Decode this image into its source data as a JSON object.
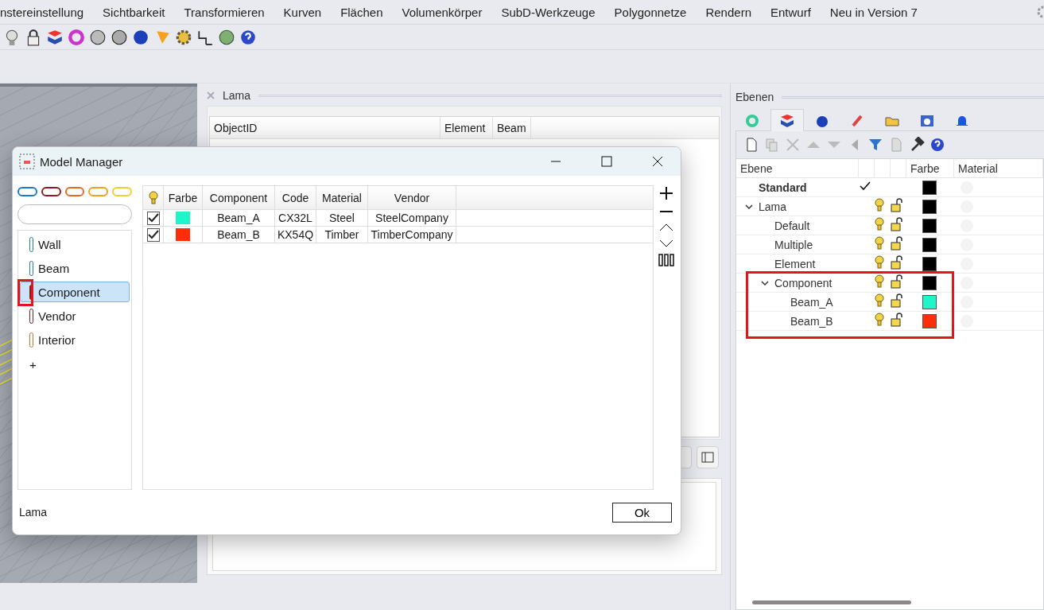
{
  "menu": [
    {
      "label": "nstereinstellung"
    },
    {
      "label": "Sichtbarkeit"
    },
    {
      "label": "Transformieren"
    },
    {
      "label": "Kurven"
    },
    {
      "label": "Flächen"
    },
    {
      "label": "Volumenkörper"
    },
    {
      "label": "SubD-Werkzeuge"
    },
    {
      "label": "Polygonnetze"
    },
    {
      "label": "Rendern"
    },
    {
      "label": "Entwurf"
    },
    {
      "label": "Neu in Version 7"
    }
  ],
  "lama_panel": {
    "title": "Lama",
    "columns": [
      "ObjectID",
      "Element",
      "Beam"
    ]
  },
  "dialog": {
    "title": "Model Manager",
    "swatches": [
      {
        "color": "#1e78c8"
      },
      {
        "color": "#8b1c1c"
      },
      {
        "color": "#e06a2a"
      },
      {
        "color": "#f0a020"
      },
      {
        "color": "#f2d030"
      }
    ],
    "categories": [
      {
        "label": "Wall",
        "color": "#1e78c8",
        "selected": false
      },
      {
        "label": "Beam",
        "color": "#1e78c8",
        "selected": false
      },
      {
        "label": "Component",
        "color": "#8b1c1c",
        "selected": true,
        "marked": true
      },
      {
        "label": "Vendor",
        "color": "#8b1c1c",
        "selected": false
      },
      {
        "label": "Interior",
        "color": "#e06a2a",
        "selected": false
      }
    ],
    "add_label": "+",
    "color_header": "Farbe",
    "columns": [
      "Component",
      "Code",
      "Material",
      "Vendor"
    ],
    "rows": [
      {
        "checked": true,
        "color": "#1ef5c8",
        "cells": [
          "Beam_A",
          "CX32L",
          "Steel",
          "SteelCompany"
        ]
      },
      {
        "checked": true,
        "color": "#ff2e08",
        "cells": [
          "Beam_B",
          "KX54Q",
          "Timber",
          "TimberCompany"
        ]
      }
    ],
    "status": "Lama",
    "ok": "Ok"
  },
  "layers": {
    "title": "Ebenen",
    "tabs": [
      {
        "selected": false
      },
      {
        "selected": true
      },
      {
        "selected": false
      },
      {
        "selected": false
      },
      {
        "selected": false
      },
      {
        "selected": false
      },
      {
        "selected": false
      }
    ],
    "columns": [
      "Ebene",
      "Farbe",
      "Material"
    ],
    "rows": [
      {
        "name": "Standard",
        "current": true,
        "color": "#000000"
      },
      {
        "name": "Lama",
        "current": false,
        "on": true,
        "locked": false,
        "color": "#000000",
        "expanded": true,
        "children": [
          {
            "name": "Default",
            "current": false,
            "on": true,
            "locked": false,
            "color": "#000000"
          },
          {
            "name": "Multiple",
            "current": false,
            "on": true,
            "locked": false,
            "color": "#000000"
          },
          {
            "name": "Element",
            "current": false,
            "on": true,
            "locked": false,
            "color": "#000000"
          },
          {
            "name": "Component",
            "current": false,
            "on": true,
            "locked": false,
            "color": "#000000",
            "expanded": true,
            "marked": true,
            "children": [
              {
                "name": "Beam_A",
                "current": false,
                "on": true,
                "locked": false,
                "color": "#1ef5c8"
              },
              {
                "name": "Beam_B",
                "current": false,
                "on": true,
                "locked": false,
                "color": "#ff2e08"
              }
            ]
          }
        ]
      }
    ]
  }
}
